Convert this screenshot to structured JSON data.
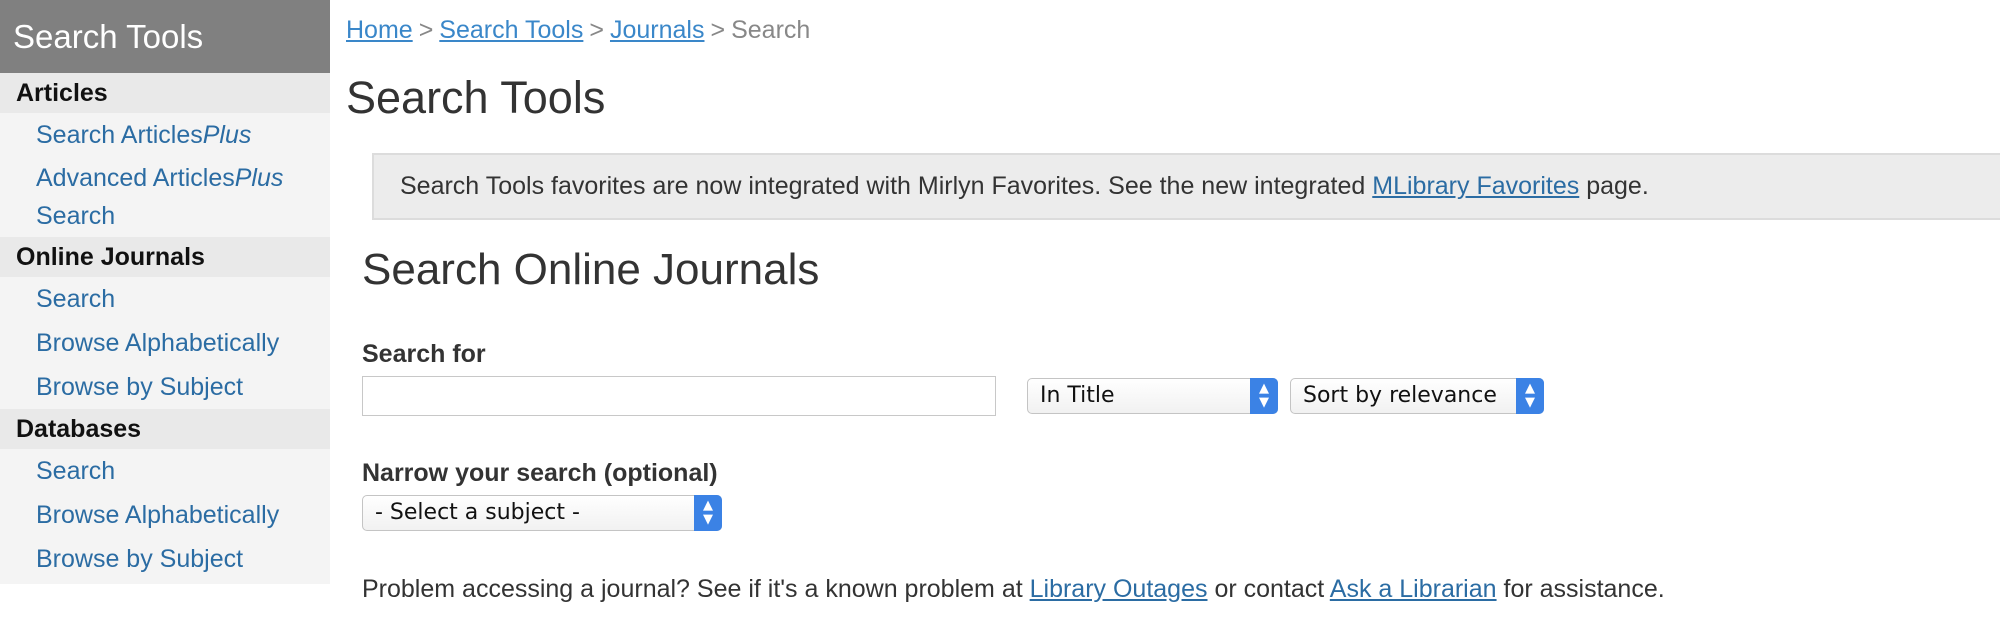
{
  "sidebar": {
    "title": "Search Tools",
    "sections": [
      {
        "title": "Articles",
        "items": [
          {
            "label": "Search Articles",
            "suffix": "Plus"
          },
          {
            "label": "Advanced Articles",
            "suffix": "Plus",
            "line2": "Search"
          }
        ]
      },
      {
        "title": "Online Journals",
        "items": [
          {
            "label": "Search"
          },
          {
            "label": "Browse Alphabetically"
          },
          {
            "label": "Browse by Subject"
          }
        ]
      },
      {
        "title": "Databases",
        "items": [
          {
            "label": "Search"
          },
          {
            "label": "Browse Alphabetically"
          },
          {
            "label": "Browse by Subject"
          }
        ]
      }
    ]
  },
  "breadcrumb": {
    "home": "Home",
    "search_tools": "Search Tools",
    "journals": "Journals",
    "current": "Search",
    "separator": ">"
  },
  "page_title": "Search Tools",
  "notice": {
    "text_before": "Search Tools favorites are now integrated with Mirlyn Favorites. See the new integrated ",
    "link": "MLibrary Favorites",
    "text_after": " page."
  },
  "search": {
    "section_title": "Search Online Journals",
    "label": "Search for",
    "input_value": "",
    "field_select": "In Title",
    "sort_select": "Sort by relevance",
    "narrow_label": "Narrow your search (optional)",
    "subject_select": "- Select a subject -"
  },
  "problem": {
    "text1": "Problem accessing a journal? See if it's a known problem at ",
    "link1": "Library Outages",
    "text2": " or contact ",
    "link2": "Ask a Librarian",
    "text3": " for assistance."
  },
  "icons": {
    "select_chevron": "chevron-updown-icon"
  },
  "colors": {
    "link": "#2b6ca3",
    "breadcrumb_link": "#3a87c9",
    "sidebar_header": "#808080",
    "select_accent": "#3b82e5"
  }
}
